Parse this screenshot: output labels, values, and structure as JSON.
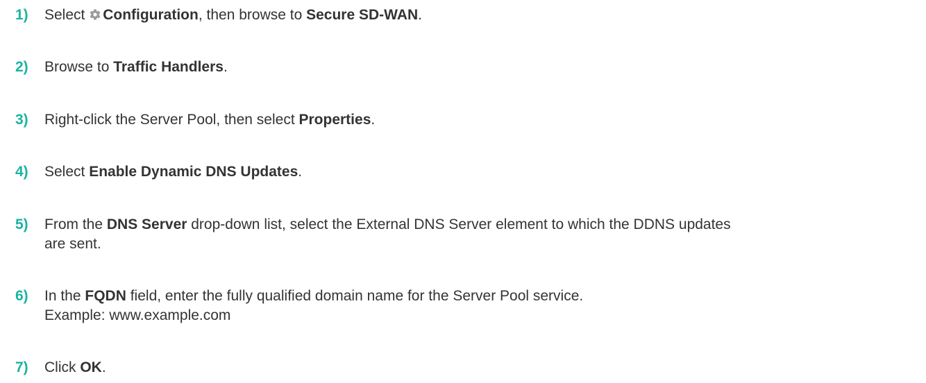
{
  "accent_color": "#1bb3a0",
  "text_color": "#333333",
  "steps": [
    {
      "number": "1)",
      "prefix": "Select ",
      "icon": "gear-icon",
      "bold1": "Configuration",
      "middle": ", then browse to ",
      "bold2": "Secure SD-WAN",
      "suffix": "."
    },
    {
      "number": "2)",
      "prefix": "Browse to ",
      "bold1": "Traffic Handlers",
      "suffix": "."
    },
    {
      "number": "3)",
      "prefix": "Right-click the Server Pool, then select ",
      "bold1": "Properties",
      "suffix": "."
    },
    {
      "number": "4)",
      "prefix": "Select ",
      "bold1": "Enable Dynamic DNS Updates",
      "suffix": "."
    },
    {
      "number": "5)",
      "prefix": "From the ",
      "bold1": "DNS Server",
      "suffix_line1": " drop-down list, select the External DNS Server element to which the DDNS updates",
      "line2": "are sent."
    },
    {
      "number": "6)",
      "prefix": "In the ",
      "bold1": "FQDN",
      "suffix": " field, enter the fully qualified domain name for the Server Pool service.",
      "line2": "Example: www.example.com"
    },
    {
      "number": "7)",
      "prefix": "Click ",
      "bold1": "OK",
      "suffix": "."
    }
  ]
}
